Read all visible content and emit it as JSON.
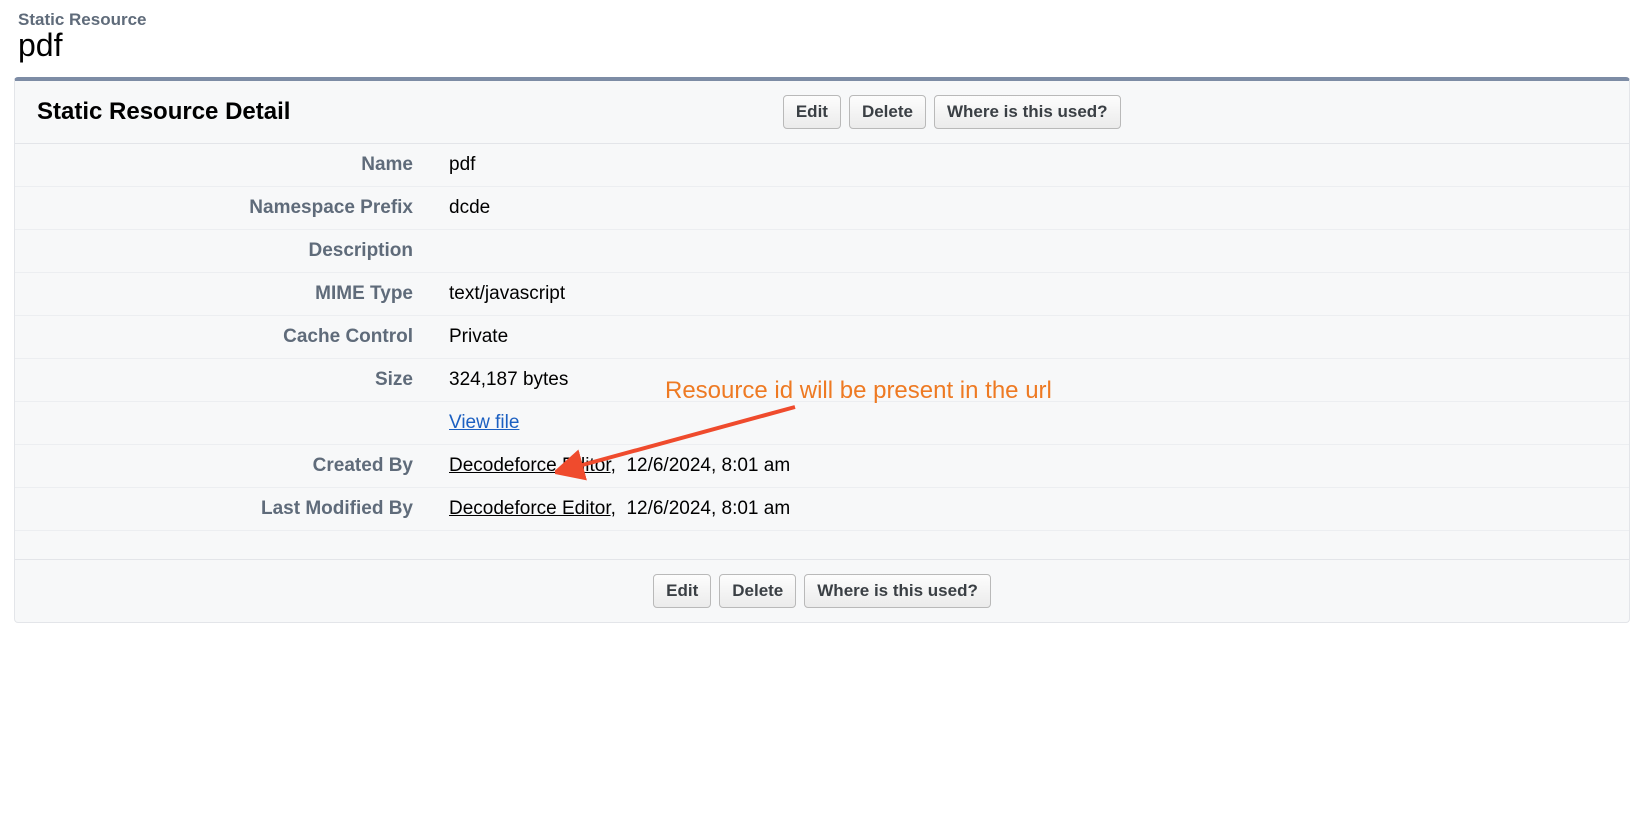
{
  "header": {
    "overline": "Static Resource",
    "title": "pdf"
  },
  "panel": {
    "title": "Static Resource Detail",
    "buttons": {
      "edit": "Edit",
      "delete": "Delete",
      "where_used": "Where is this used?"
    }
  },
  "details": {
    "labels": {
      "name": "Name",
      "namespace_prefix": "Namespace Prefix",
      "description": "Description",
      "mime_type": "MIME Type",
      "cache_control": "Cache Control",
      "size": "Size",
      "view_file": "View file",
      "created_by": "Created By",
      "last_modified_by": "Last Modified By"
    },
    "values": {
      "name": "pdf",
      "namespace_prefix": "dcde",
      "description": "",
      "mime_type": "text/javascript",
      "cache_control": "Private",
      "size": "324,187 bytes",
      "created_by_user": "Decodeforce Editor",
      "created_by_ts": "12/6/2024, 8:01 am",
      "last_modified_user": "Decodeforce Editor",
      "last_modified_ts": "12/6/2024, 8:01 am"
    }
  },
  "annotation": {
    "text": "Resource id will be present in the url"
  }
}
